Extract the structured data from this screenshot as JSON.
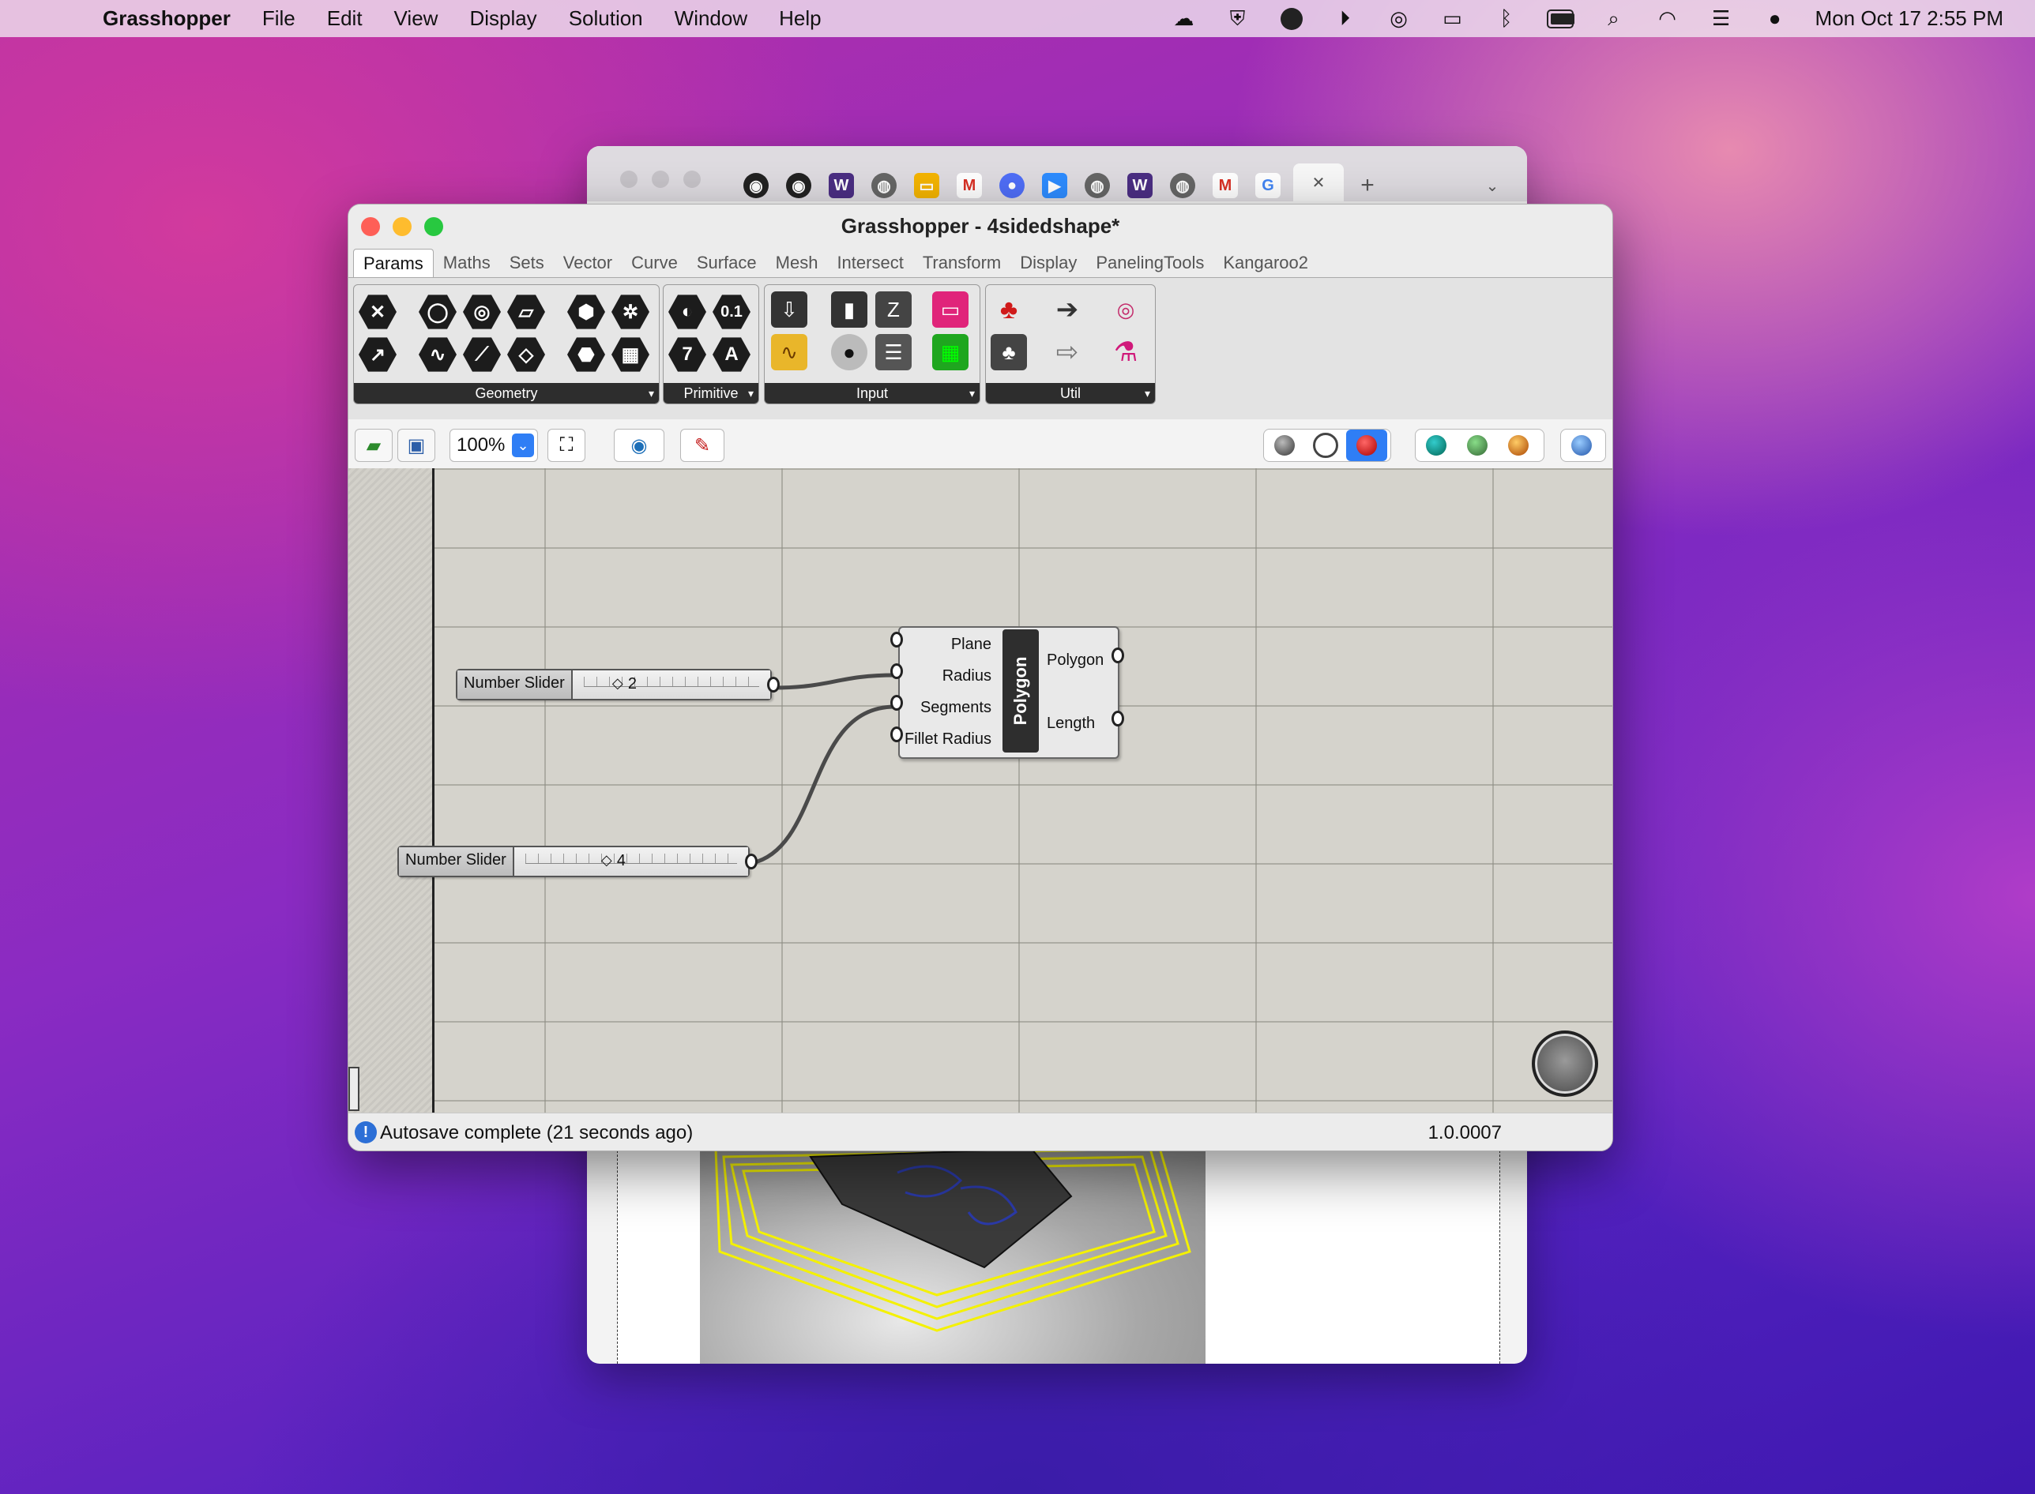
{
  "menubar": {
    "app": "Grasshopper",
    "items": [
      "File",
      "Edit",
      "View",
      "Display",
      "Solution",
      "Window",
      "Help"
    ],
    "clock": "Mon Oct 17  2:55 PM"
  },
  "gh": {
    "title": "Grasshopper - 4sidedshape*",
    "tabs": [
      "Params",
      "Maths",
      "Sets",
      "Vector",
      "Curve",
      "Surface",
      "Mesh",
      "Intersect",
      "Transform",
      "Display",
      "PanelingTools",
      "Kangaroo2"
    ],
    "groups": {
      "geometry": "Geometry",
      "primitive": "Primitive",
      "input": "Input",
      "util": "Util"
    },
    "primitive_icons": {
      "decimal": "0.1",
      "integer": "7",
      "text": "A"
    },
    "zoom": "100%",
    "sliders": [
      {
        "name": "Number Slider",
        "value": "2"
      },
      {
        "name": "Number Slider",
        "value": "4"
      }
    ],
    "component": {
      "name": "Polygon",
      "inputs": [
        "Plane",
        "Radius",
        "Segments",
        "Fillet Radius"
      ],
      "outputs": [
        "Polygon",
        "Length"
      ]
    },
    "status": {
      "message": "Autosave complete (21 seconds ago)",
      "version": "1.0.0007"
    }
  }
}
